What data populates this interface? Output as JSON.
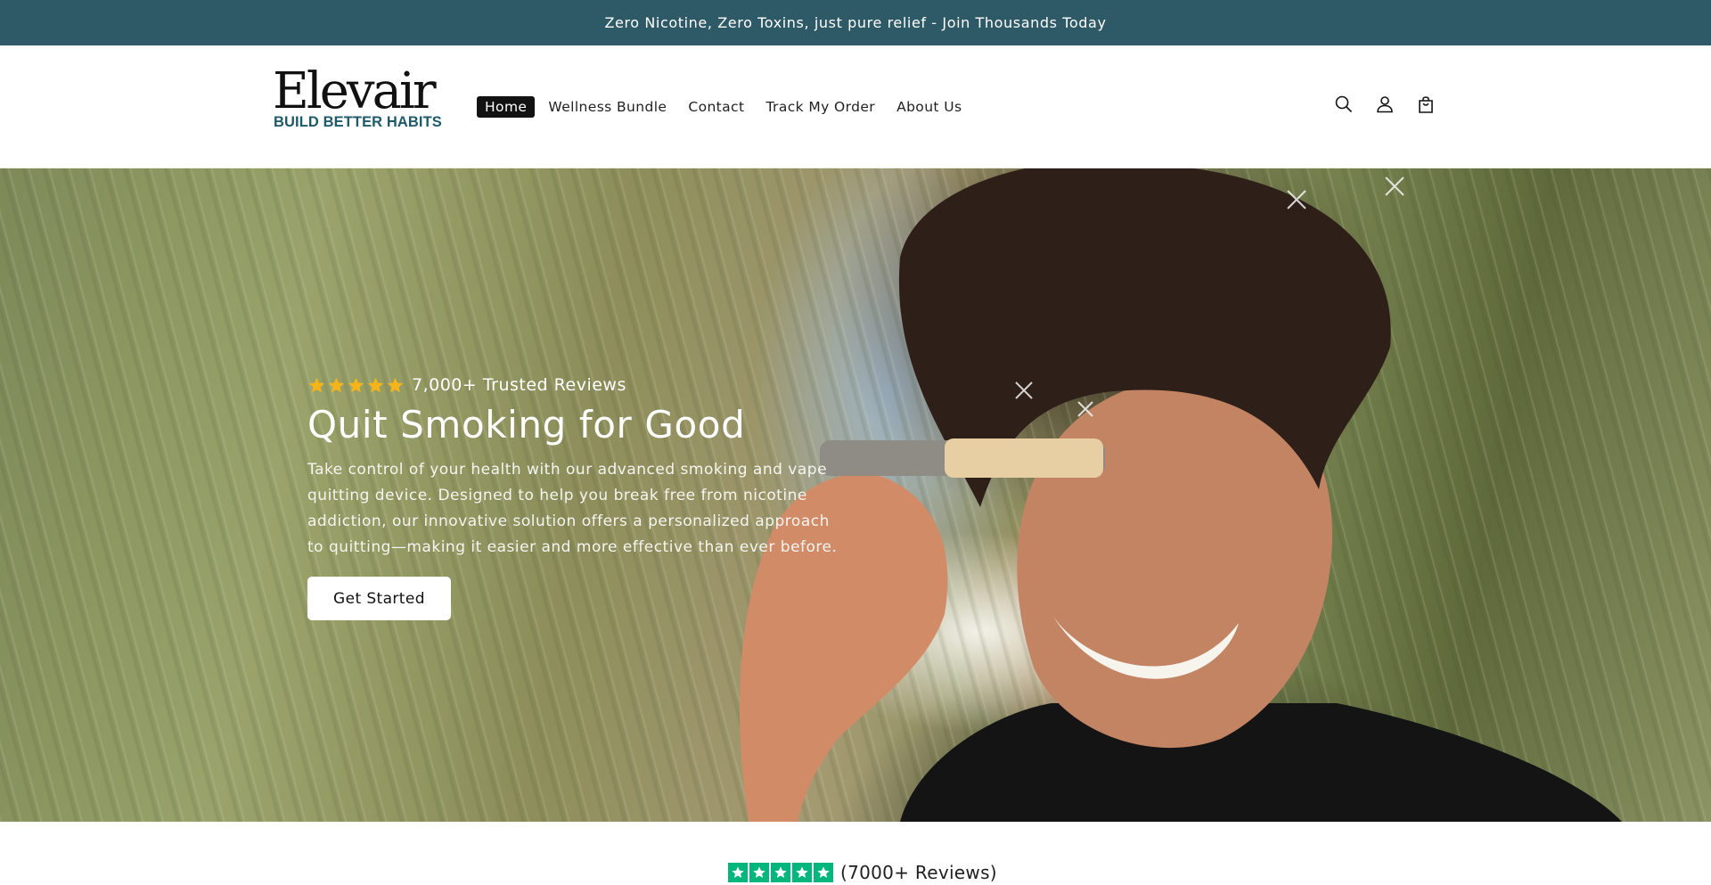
{
  "announcement": {
    "text": "Zero Nicotine, Zero Toxins, just pure relief - Join Thousands Today"
  },
  "header": {
    "logo": {
      "name": "Elevair",
      "tagline": "BUILD BETTER HABITS"
    },
    "nav": [
      {
        "label": "Home",
        "active": true
      },
      {
        "label": "Wellness Bundle",
        "active": false
      },
      {
        "label": "Contact",
        "active": false
      },
      {
        "label": "Track My Order",
        "active": false
      },
      {
        "label": "About Us",
        "active": false
      }
    ],
    "icons": [
      "search-icon",
      "account-icon",
      "cart-icon"
    ]
  },
  "hero": {
    "rating": {
      "stars": 5,
      "text": "7,000+ Trusted Reviews"
    },
    "title": "Quit Smoking for Good",
    "description": "Take control of your health with our advanced smoking and vape quitting device. Designed to help you break free from nicotine addiction, our innovative solution offers a personalized approach to quitting—making it easier and more effective than ever before.",
    "cta_label": "Get Started"
  },
  "reviews": {
    "stars": 5,
    "text": "(7000+ Reviews)"
  },
  "colors": {
    "announcement_bg": "#2e5966",
    "logo_tagline": "#1f5a6b",
    "star_gold": "#f5b41a",
    "trustpilot_green": "#00b67a"
  }
}
